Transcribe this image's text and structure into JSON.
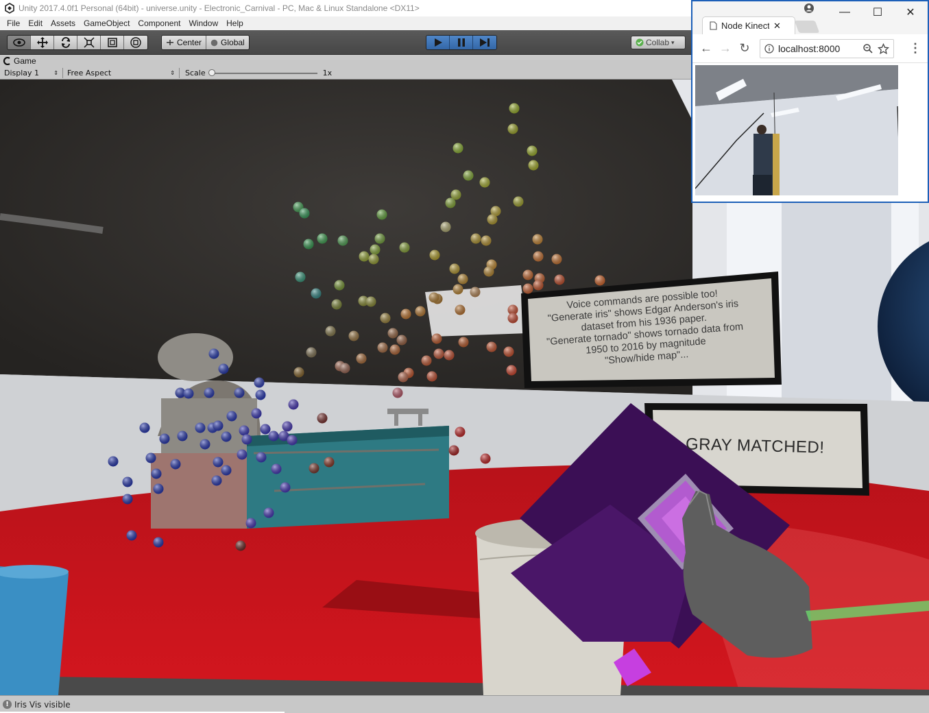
{
  "unity": {
    "title": "Unity 2017.4.0f1 Personal (64bit) - universe.unity - Electronic_Carnival - PC, Mac & Linux Standalone <DX11>",
    "menu": [
      "File",
      "Edit",
      "Assets",
      "GameObject",
      "Component",
      "Window",
      "Help"
    ],
    "toolbar": {
      "tools": [
        "hand-tool-icon",
        "move-tool-icon",
        "rotate-tool-icon",
        "scale-tool-icon",
        "rect-tool-icon",
        "transform-tool-icon"
      ],
      "pivot_label": "Center",
      "space_label": "Global",
      "collab_label": "Collab"
    },
    "game_view": {
      "tab_label": "Game",
      "display": "Display 1",
      "aspect": "Free Aspect",
      "scale_label": "Scale",
      "scale_value": "1x"
    },
    "scene_text": {
      "voice_panel": [
        "Voice commands are possible too!",
        "\"Generate iris\" shows Edgar Anderson's iris",
        "dataset from his 1936 paper.",
        "\"Generate tornado\" shows tornado data from",
        "1950 to 2016 by magnitude",
        "\"Show/hide map\"..."
      ],
      "match_panel": "GRAY MATCHED!"
    },
    "status": "Iris Vis visible"
  },
  "chrome": {
    "tab_title": "Node Kinect",
    "url": "localhost:8000"
  },
  "colors": {
    "toolbar_dark": "#4a4a4a",
    "play_blue": "#3c72b8",
    "table_red": "#c0141a",
    "purple": "#3d1456"
  }
}
